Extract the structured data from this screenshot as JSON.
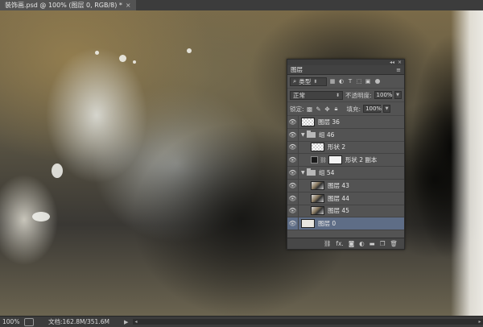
{
  "document_tab": {
    "title": "装饰画.psd @ 100% (图层 0, RGB/8) *",
    "close": "×"
  },
  "layers_panel": {
    "tab_label": "图层",
    "collapse": "◂◂",
    "close": "×",
    "menu": "≡",
    "filter": {
      "icon": "search-icon",
      "label": "类型"
    },
    "blend_mode": "正常",
    "opacity_label": "不透明度:",
    "opacity": "100%",
    "lock_label": "锁定:",
    "fill_label": "填充:",
    "fill": "100%",
    "layers": [
      {
        "name": "图层 36",
        "kind": "layer",
        "thumb": "checker"
      },
      {
        "name": "组 46",
        "kind": "group-open"
      },
      {
        "name": "形状 2",
        "kind": "layer",
        "thumb": "checker",
        "indent": 1
      },
      {
        "name": "形状 2 副本",
        "kind": "shape",
        "thumb": "white",
        "indent": 1
      },
      {
        "name": "组 54",
        "kind": "group-open"
      },
      {
        "name": "图层 43",
        "kind": "layer",
        "thumb": "mixed",
        "indent": 1
      },
      {
        "name": "图层 44",
        "kind": "layer",
        "thumb": "mixed",
        "indent": 1
      },
      {
        "name": "图层 45",
        "kind": "layer",
        "thumb": "mixed",
        "indent": 1
      },
      {
        "name": "图层 0",
        "kind": "layer",
        "thumb": "plain",
        "selected": true
      }
    ],
    "footer_icons": [
      "link-icon",
      "fx-icon",
      "mask-icon",
      "adjustment-icon",
      "folder-icon",
      "new-layer-icon",
      "trash-icon"
    ],
    "footer_fx": "fx."
  },
  "status_bar": {
    "zoom": "100%",
    "doc_info": "文档:162.8M/351.6M",
    "arrow": "▶"
  }
}
